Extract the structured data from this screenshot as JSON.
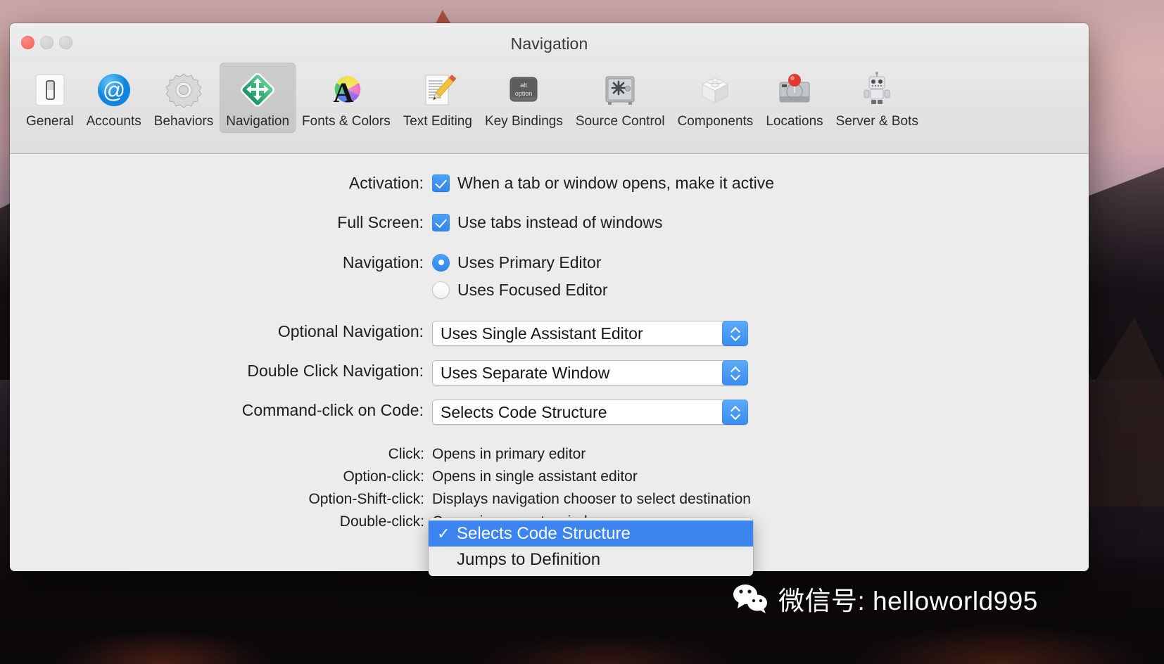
{
  "window": {
    "title": "Navigation",
    "traffic_lights": [
      "close",
      "minimize",
      "zoom"
    ]
  },
  "toolbar": {
    "items": [
      {
        "label": "General",
        "icon": "switch-icon",
        "selected": false
      },
      {
        "label": "Accounts",
        "icon": "at-sign-icon",
        "selected": false
      },
      {
        "label": "Behaviors",
        "icon": "gear-icon",
        "selected": false
      },
      {
        "label": "Navigation",
        "icon": "move-arrows-icon",
        "selected": true
      },
      {
        "label": "Fonts & Colors",
        "icon": "color-wheel-a-icon",
        "selected": false
      },
      {
        "label": "Text Editing",
        "icon": "document-pencil-icon",
        "selected": false
      },
      {
        "label": "Key Bindings",
        "icon": "option-key-icon",
        "selected": false
      },
      {
        "label": "Source Control",
        "icon": "safe-vault-icon",
        "selected": false
      },
      {
        "label": "Components",
        "icon": "lego-brick-icon",
        "selected": false
      },
      {
        "label": "Locations",
        "icon": "hard-drive-pin-icon",
        "selected": false
      },
      {
        "label": "Server & Bots",
        "icon": "robot-icon",
        "selected": false
      }
    ]
  },
  "settings": {
    "activation": {
      "label": "Activation:",
      "checkbox_label": "When a tab or window opens, make it active",
      "checked": true
    },
    "full_screen": {
      "label": "Full Screen:",
      "checkbox_label": "Use tabs instead of windows",
      "checked": true
    },
    "navigation": {
      "label": "Navigation:",
      "options": [
        {
          "label": "Uses Primary Editor",
          "selected": true
        },
        {
          "label": "Uses Focused Editor",
          "selected": false
        }
      ]
    },
    "optional_navigation": {
      "label": "Optional Navigation:",
      "value": "Uses Single Assistant Editor"
    },
    "double_click_navigation": {
      "label": "Double Click Navigation:",
      "value": "Uses Separate Window"
    },
    "command_click": {
      "label": "Command-click on Code:",
      "value": "Selects Code Structure"
    }
  },
  "open_menu": {
    "items": [
      {
        "label": "Selects Code Structure",
        "checked": true,
        "highlighted": true,
        "check_glyph": "✓"
      },
      {
        "label": "Jumps to Definition",
        "checked": false,
        "highlighted": false,
        "check_glyph": ""
      }
    ]
  },
  "summary": {
    "rows": [
      {
        "key": "Click:",
        "value": "Opens in primary editor"
      },
      {
        "key": "Option-click:",
        "value": "Opens in single assistant editor"
      },
      {
        "key": "Option-Shift-click:",
        "value": "Displays navigation chooser to select destination"
      },
      {
        "key": "Double-click:",
        "value": "Opens in separate window"
      }
    ]
  },
  "watermark": {
    "text": "微信号: helloworld995",
    "logo": "wechat-icon"
  },
  "colors": {
    "accent_blue": "#3c85f0",
    "control_blue": "#2f86ef",
    "window_bg": "#ececec",
    "toolbar_bg": "#e4e4e4",
    "selected_tab_bg": "#c9c9c9",
    "text": "#1d1d1d",
    "close_red": "#fa5e55"
  }
}
